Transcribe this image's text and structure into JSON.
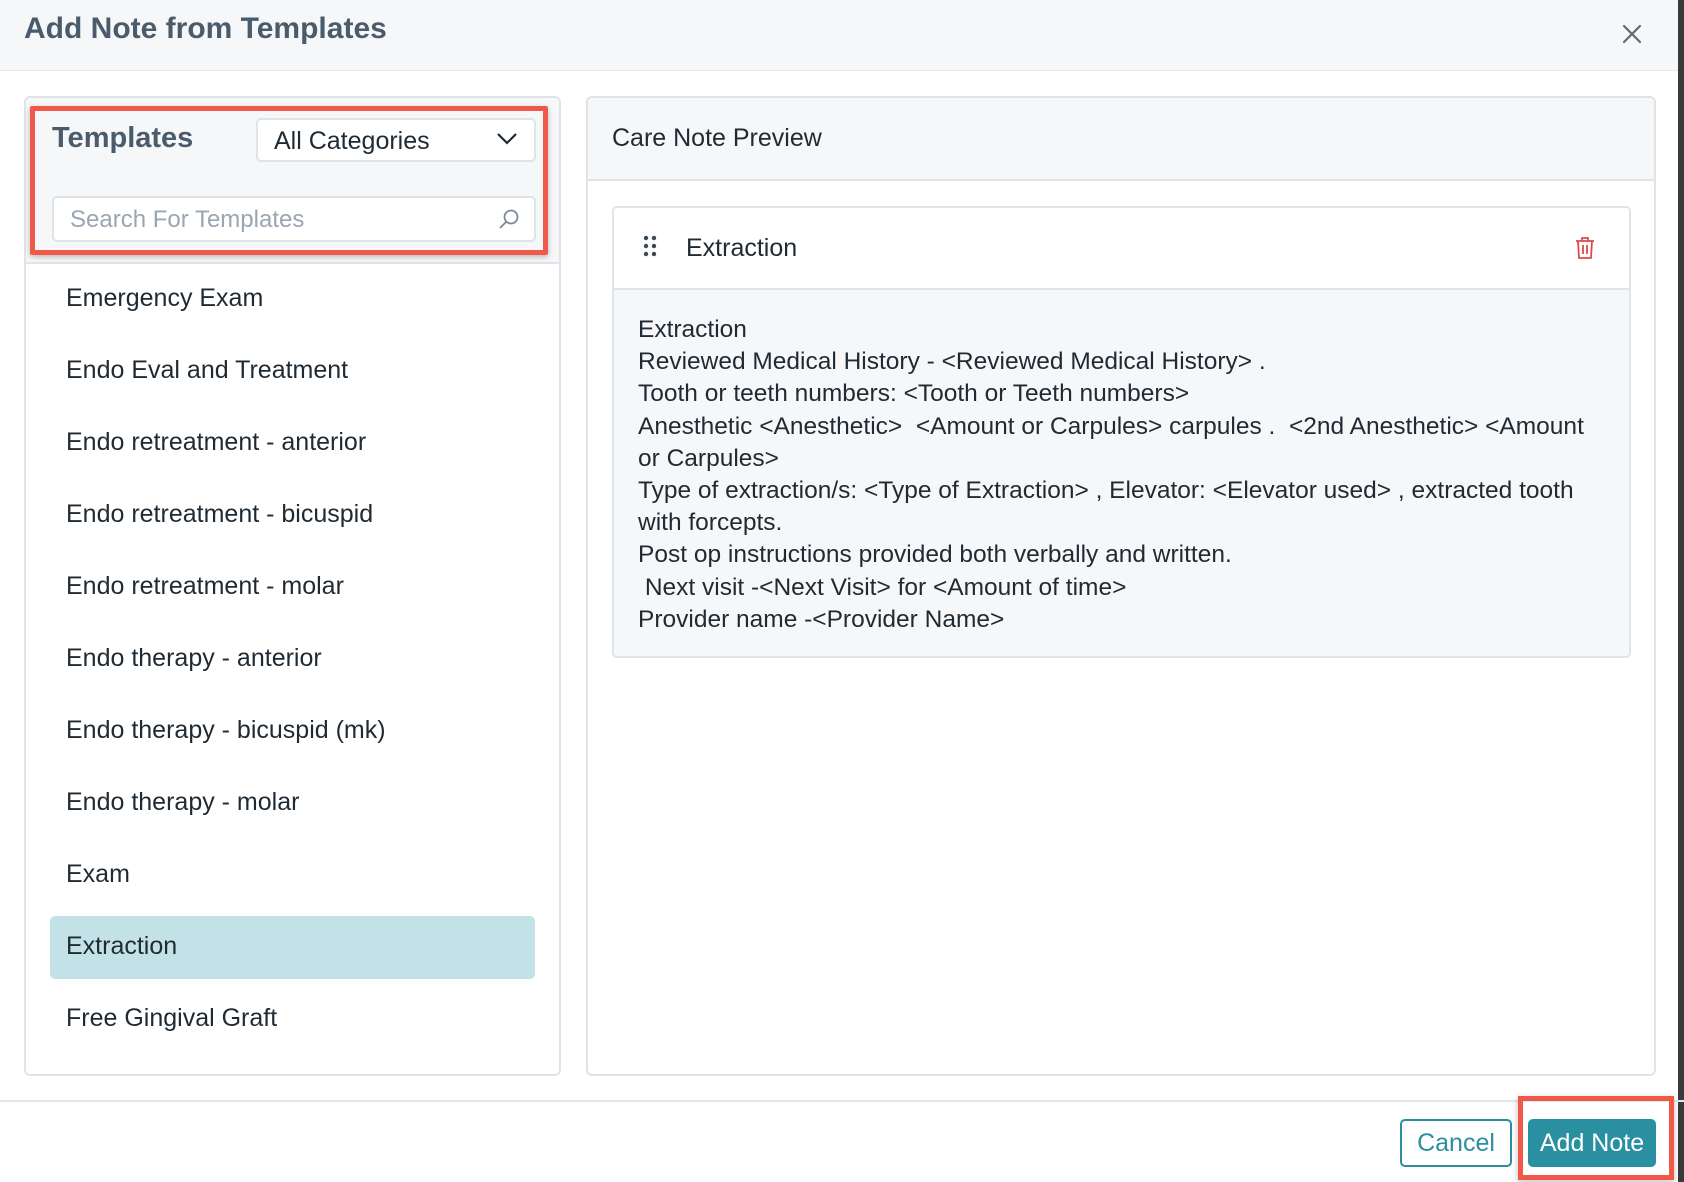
{
  "modal": {
    "title": "Add Note from Templates"
  },
  "templates_panel": {
    "heading": "Templates",
    "category_select": {
      "value": "All Categories"
    },
    "search": {
      "placeholder": "Search For Templates",
      "value": ""
    },
    "items": [
      {
        "label": "Emergency Exam",
        "selected": false
      },
      {
        "label": "Endo Eval and Treatment",
        "selected": false
      },
      {
        "label": "Endo retreatment - anterior",
        "selected": false
      },
      {
        "label": "Endo retreatment - bicuspid",
        "selected": false
      },
      {
        "label": "Endo retreatment - molar",
        "selected": false
      },
      {
        "label": "Endo therapy - anterior",
        "selected": false
      },
      {
        "label": "Endo therapy - bicuspid (mk)",
        "selected": false
      },
      {
        "label": "Endo therapy - molar",
        "selected": false
      },
      {
        "label": "Exam",
        "selected": false
      },
      {
        "label": "Extraction",
        "selected": true
      },
      {
        "label": "Free Gingival Graft",
        "selected": false
      }
    ]
  },
  "preview_panel": {
    "title": "Care Note Preview",
    "note": {
      "title": "Extraction",
      "lines": [
        "Extraction",
        "Reviewed Medical History - <Reviewed Medical History> .",
        "Tooth or teeth numbers: <Tooth or Teeth numbers>",
        "Anesthetic <Anesthetic>  <Amount or Carpules> carpules .  <2nd Anesthetic> <Amount or Carpules>",
        "Type of extraction/s: <Type of Extraction> , Elevator: <Elevator used> , extracted tooth with forcepts.",
        "Post op instructions provided both verbally and written.",
        " Next visit -<Next Visit> for <Amount of time>",
        "Provider name -<Provider Name>"
      ]
    }
  },
  "footer": {
    "cancel_label": "Cancel",
    "add_note_label": "Add Note"
  },
  "icons": {
    "close": "close-icon",
    "dropdown": "chevron-down-icon",
    "search": "search-icon",
    "drag": "drag-handle-icon",
    "delete": "trash-icon"
  },
  "colors": {
    "accent": "#2a8fa0",
    "selected_row": "#c3e2e7",
    "annotation_highlight": "#f0584a",
    "delete_icon": "#e04848"
  }
}
